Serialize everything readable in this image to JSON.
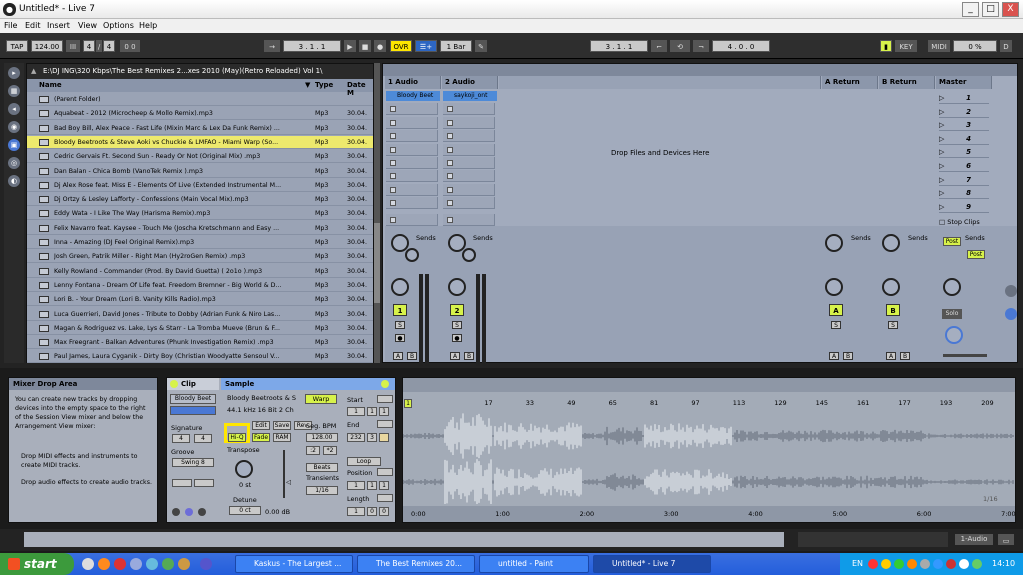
{
  "window": {
    "title": "Untitled* - Live 7",
    "min": "_",
    "max": "□",
    "close": "X"
  },
  "menu": [
    "File",
    "Edit",
    "Insert",
    "View",
    "Options",
    "Help"
  ],
  "control": {
    "tap": "TAP",
    "tempo": "124.00",
    "meter_sym": "III",
    "sig_num": "4",
    "sig_sep": "/",
    "sig_den": "4",
    "metro": "0 0",
    "arr_pos": "3 . 1 . 1",
    "ovr": "OVR",
    "quant": "1 Bar",
    "loop_start": "3 . 1 . 1",
    "loop_len": "4 . 0 . 0",
    "key": "KEY",
    "midi": "MIDI",
    "cpu": "0 %",
    "d": "D"
  },
  "browser": {
    "path": "E:\\DJ ING\\320 Kbps\\The Best Remixes 2...xes 2010 (May)(Retro Reloaded) Vol 1\\",
    "col_name": "Name",
    "col_type": "Type",
    "col_date": "Date M",
    "files": [
      {
        "n": "(Parent Folder)",
        "t": "",
        "d": ""
      },
      {
        "n": "Aquabeat - 2012 (Microcheep & Mollo Remix).mp3",
        "t": "Mp3",
        "d": "30.04."
      },
      {
        "n": "Bad Boy Bill, Alex Peace - Fast Life (Mixin Marc & Lex Da Funk Remix) ...",
        "t": "Mp3",
        "d": "30.04."
      },
      {
        "n": "Bloody Beetroots & Steve Aoki vs Chuckie & LMFAO - Miami Warp (So...",
        "t": "Mp3",
        "d": "30.04."
      },
      {
        "n": "Cedric Gervais Ft. Second Sun - Ready Or Not (Original Mix) .mp3",
        "t": "Mp3",
        "d": "30.04."
      },
      {
        "n": "Dan Balan - Chica Bomb (VanoTek Remix ).mp3",
        "t": "Mp3",
        "d": "30.04."
      },
      {
        "n": "Dj Alex Rose feat. Miss E - Elements Of Live (Extended Instrumental M...",
        "t": "Mp3",
        "d": "30.04."
      },
      {
        "n": "Dj Ortzy & Lesley Lafforty - Confessions (Main Vocal Mix).mp3",
        "t": "Mp3",
        "d": "30.04."
      },
      {
        "n": "Eddy Wata - I Like The Way (Harisma Remix).mp3",
        "t": "Mp3",
        "d": "30.04."
      },
      {
        "n": "Felix Navarro feat. Kaysee - Touch Me (Joscha Kretschmann and Easy ...",
        "t": "Mp3",
        "d": "30.04."
      },
      {
        "n": "Inna - Amazing (DJ Feel Original Remix).mp3",
        "t": "Mp3",
        "d": "30.04."
      },
      {
        "n": "Josh Green, Patrik Miller - Right Man (Hy2roGen Remix) .mp3",
        "t": "Mp3",
        "d": "30.04."
      },
      {
        "n": "Kelly Rowland - Commander (Prod. By David Guetta) ( 2o1o ).mp3",
        "t": "Mp3",
        "d": "30.04."
      },
      {
        "n": "Lenny Fontana - Dream Of Life feat. Freedom Bremner - Big World & D...",
        "t": "Mp3",
        "d": "30.04."
      },
      {
        "n": "Lori B. - Your Dream (Lori B. Vanity Kills Radio).mp3",
        "t": "Mp3",
        "d": "30.04."
      },
      {
        "n": "Luca Guerrieri, David Jones - Tribute to Dobby (Adrian Funk & Niro Las...",
        "t": "Mp3",
        "d": "30.04."
      },
      {
        "n": "Magan & Rodriguez vs. Lake, Lys & Starr - La Tromba Mueve (Brun & F...",
        "t": "Mp3",
        "d": "30.04."
      },
      {
        "n": "Max Freegrant - Balkan Adventures (Phunk Investigation Remix) .mp3",
        "t": "Mp3",
        "d": "30.04."
      },
      {
        "n": "Paul James, Laura Cyganik - Dirty Boy (Christian Woodyatte Sensoul V...",
        "t": "Mp3",
        "d": "30.04."
      }
    ]
  },
  "session": {
    "tracks": [
      "1 Audio",
      "2 Audio",
      "A Return",
      "B Return",
      "Master"
    ],
    "clip1": "Bloody Beet",
    "clip2": "saykoji_ont",
    "drop": "Drop Files and Devices Here",
    "scenes": [
      "1",
      "2",
      "3",
      "4",
      "5",
      "6",
      "7",
      "8",
      "9"
    ],
    "stop_clips": "Stop Clips",
    "sends": "Sends",
    "post": "Post",
    "a": "A",
    "b": "B",
    "s": "S",
    "t1": "1",
    "t2": "2",
    "ta": "A",
    "tb": "B",
    "solo": "Solo",
    "knob_a": "A",
    "knob_b": "B"
  },
  "info": {
    "title": "Mixer Drop Area",
    "body": "You can create new tracks by dropping devices into the empty space to the right of the Session View mixer and below the Arrangement View mixer:",
    "b1": "Drop MIDI effects and instruments to create MIDI tracks.",
    "b2": "Drop audio effects to create audio tracks."
  },
  "clipv": {
    "clip": "Clip",
    "name": "Bloody Beet",
    "signature": "Signature",
    "sig_n": "4",
    "sig_d": "4",
    "groove": "Groove",
    "swing": "Swing 8",
    "sample": "Sample",
    "sname": "Bloody Beetroots & S",
    "sinfo": "44.1 kHz 16 Bit 2 Ch",
    "edit": "Edit",
    "save": "Save",
    "rev": "Rev.",
    "hiq": "Hi-Q",
    "fade": "Fade",
    "ram": "RAM",
    "transpose": "Transpose",
    "st": "0 st",
    "vol": "0.00 dB",
    "detune": "Detune",
    "ct": "0 ct",
    "warp": "Warp",
    "segbpm": "Seg. BPM",
    "bpm": "128.00",
    "half": ":2",
    "dbl": "*2",
    "beats": "Beats",
    "transients": "Transients",
    "tr": "1/16",
    "start": "Start",
    "end": "End",
    "loop": "Loop",
    "position": "Position",
    "length": "Length",
    "s1": "1",
    "s2": "1",
    "s3": "1",
    "e1": "232",
    "e2": "3",
    "p1": "1",
    "p2": "1",
    "p3": "1",
    "l1": "1",
    "l2": "0",
    "l3": "0"
  },
  "wave": {
    "bars": [
      "1",
      "17",
      "33",
      "49",
      "65",
      "81",
      "97",
      "113",
      "129",
      "145",
      "161",
      "177",
      "193",
      "209",
      "225"
    ],
    "times": [
      "0:00",
      "1:00",
      "2:00",
      "3:00",
      "4:00",
      "5:00",
      "6:00",
      "7:00"
    ],
    "flag": "1",
    "ratio": "1/16"
  },
  "status": {
    "track": "1-Audio"
  },
  "taskbar": {
    "start": "start",
    "t1": "Kaskus - The Largest ...",
    "t2": "The Best Remixes 20...",
    "t3": "untitled - Paint",
    "t4": "Untitled* - Live 7",
    "lang": "EN",
    "clock": "14:10"
  }
}
